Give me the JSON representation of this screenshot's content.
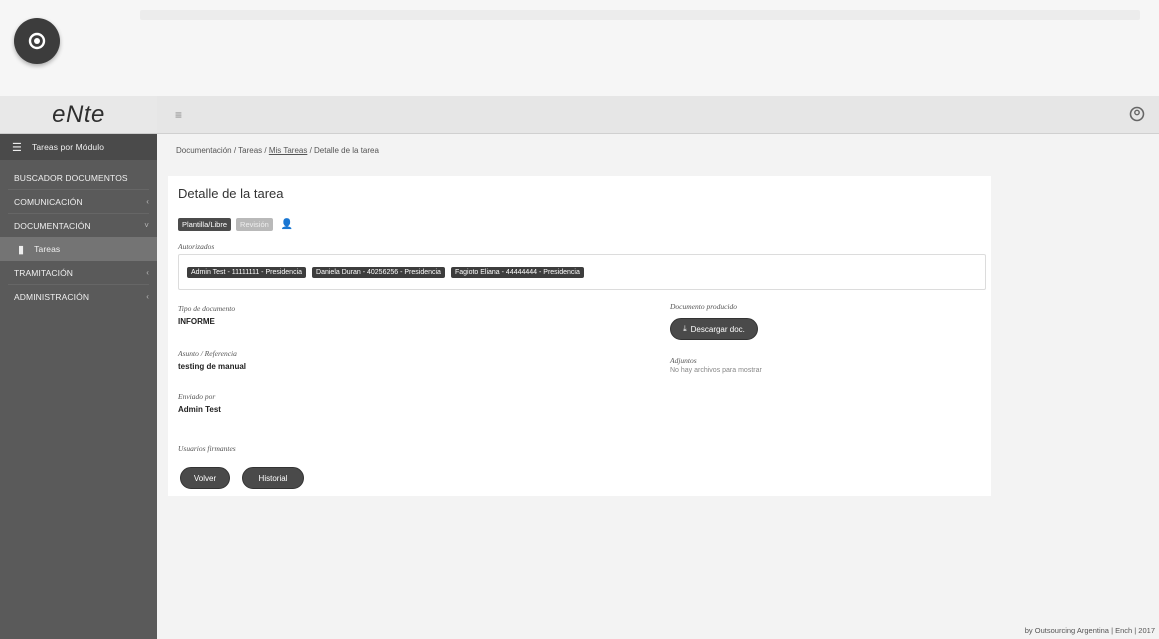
{
  "app": {
    "logo": "eNte",
    "footer": "by Outsourcing Argentina | Ench | 2017"
  },
  "sidebar": {
    "items": [
      {
        "label": "Tareas por Módulo",
        "icon": "list-icon"
      },
      {
        "label": "BUSCADOR DOCUMENTOS"
      },
      {
        "label": "COMUNICACIÓN",
        "chevron": "‹"
      },
      {
        "label": "DOCUMENTACIÓN",
        "chevron": "˅"
      },
      {
        "label": "Tareas",
        "icon": "document-icon"
      },
      {
        "label": "TRAMITACIÓN",
        "chevron": "‹"
      },
      {
        "label": "ADMINISTRACIÓN",
        "chevron": "‹"
      }
    ]
  },
  "breadcrumb": {
    "part1": "Documentación",
    "part2": "Tareas",
    "part3": "Mis Tareas",
    "part4": "Detalle de la tarea",
    "sep": " / "
  },
  "detail": {
    "title": "Detalle de la tarea",
    "badge_plantilla": "Plantilla/Libre",
    "badge_status": "Revisión",
    "authorized_label": "Autorizados",
    "authorized": [
      "Admin Test - 11111111 - Presidencia",
      "Daniela Duran - 40256256 - Presidencia",
      "Fagioto Eliana - 44444444 - Presidencia"
    ],
    "doc_type_label": "Tipo de documento",
    "doc_type_value": "INFORME",
    "subject_label": "Asunto / Referencia",
    "subject_value": "testing de manual",
    "sent_by_label": "Enviado por",
    "sent_by_value": "Admin Test",
    "signers_label": "Usuarios firmantes",
    "produced_doc_label": "Documento producido",
    "download_button": "Descargar doc.",
    "attachments_label": "Adjuntos",
    "attachments_empty": "No hay archivos para mostrar",
    "back_button": "Volver",
    "history_button": "Historial"
  }
}
